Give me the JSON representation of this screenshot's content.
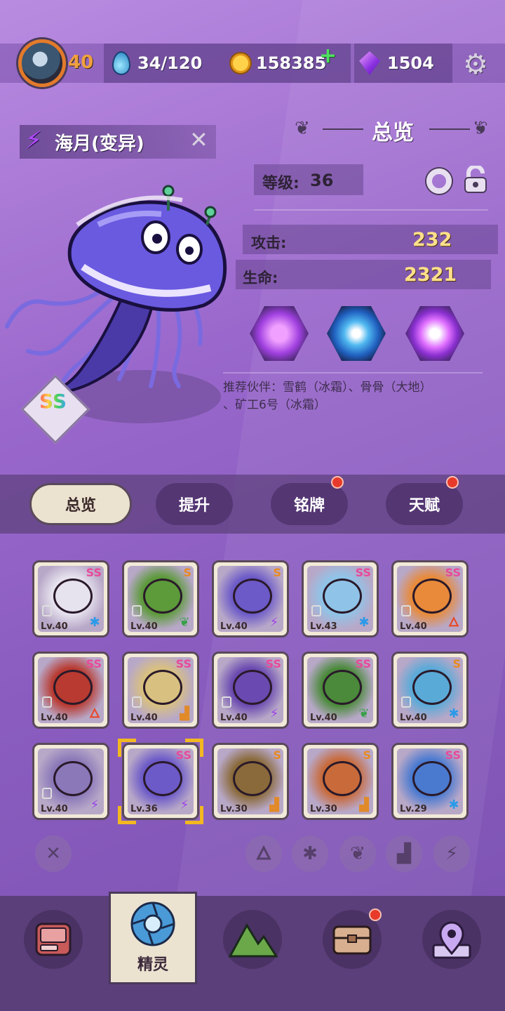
{
  "top_bar": {
    "player_level": "40",
    "stamina": "34/120",
    "coins": "158385",
    "gems": "1504"
  },
  "pet": {
    "name": "海月(变异)",
    "rank": "SS",
    "level_label": "等级:",
    "level_value": "36",
    "attack_label": "攻击:",
    "attack_value": "232",
    "hp_label": "生命:",
    "hp_value": "2321",
    "recommend_line1": "推荐伙伴：雪鹤（冰霜）、骨骨（大地）",
    "recommend_line2": "、矿工6号（冰霜）"
  },
  "panel_title": "总览",
  "tabs": [
    {
      "label": "总览",
      "active": true,
      "badge": false
    },
    {
      "label": "提升",
      "active": false,
      "badge": false
    },
    {
      "label": "铭牌",
      "active": false,
      "badge": true
    },
    {
      "label": "天赋",
      "active": false,
      "badge": true
    }
  ],
  "roster": [
    {
      "lv": "Lv.40",
      "rank": "SS",
      "element": "ice",
      "color": "#e6e2ee",
      "locked": true
    },
    {
      "lv": "Lv.40",
      "rank": "S",
      "element": "leaf",
      "color": "#5c9a3a",
      "locked": true
    },
    {
      "lv": "Lv.40",
      "rank": "S",
      "element": "bolt",
      "color": "#6c5ac8",
      "locked": false
    },
    {
      "lv": "Lv.43",
      "rank": "SS",
      "element": "ice",
      "color": "#8fc4e8",
      "locked": true
    },
    {
      "lv": "Lv.40",
      "rank": "SS",
      "element": "fire",
      "color": "#e88a3a",
      "locked": true
    },
    {
      "lv": "Lv.40",
      "rank": "SS",
      "element": "fire",
      "color": "#b83a30",
      "locked": true
    },
    {
      "lv": "Lv.40",
      "rank": "SS",
      "element": "earth",
      "color": "#d8c080",
      "locked": true
    },
    {
      "lv": "Lv.40",
      "rank": "SS",
      "element": "bolt",
      "color": "#6a4ab0",
      "locked": true
    },
    {
      "lv": "Lv.40",
      "rank": "SS",
      "element": "leaf",
      "color": "#4a8a3a",
      "locked": false
    },
    {
      "lv": "Lv.40",
      "rank": "S",
      "element": "ice",
      "color": "#5aaad8",
      "locked": true
    },
    {
      "lv": "Lv.40",
      "rank": "",
      "element": "bolt",
      "color": "#8a78b8",
      "locked": true
    },
    {
      "lv": "Lv.36",
      "rank": "SS",
      "element": "bolt",
      "color": "#6c5ac8",
      "locked": false,
      "selected": true
    },
    {
      "lv": "Lv.30",
      "rank": "S",
      "element": "earth",
      "color": "#8a6a3a",
      "locked": false
    },
    {
      "lv": "Lv.30",
      "rank": "S",
      "element": "earth",
      "color": "#c86a3a",
      "locked": false
    },
    {
      "lv": "Lv.29",
      "rank": "SS",
      "element": "ice",
      "color": "#4a7ad0",
      "locked": false
    }
  ],
  "bottom_nav": {
    "active_label": "精灵"
  },
  "colors": {
    "accent_gold": "#ffe08a",
    "badge_red": "#e83a2a",
    "tab_active": "#ece2d0"
  }
}
